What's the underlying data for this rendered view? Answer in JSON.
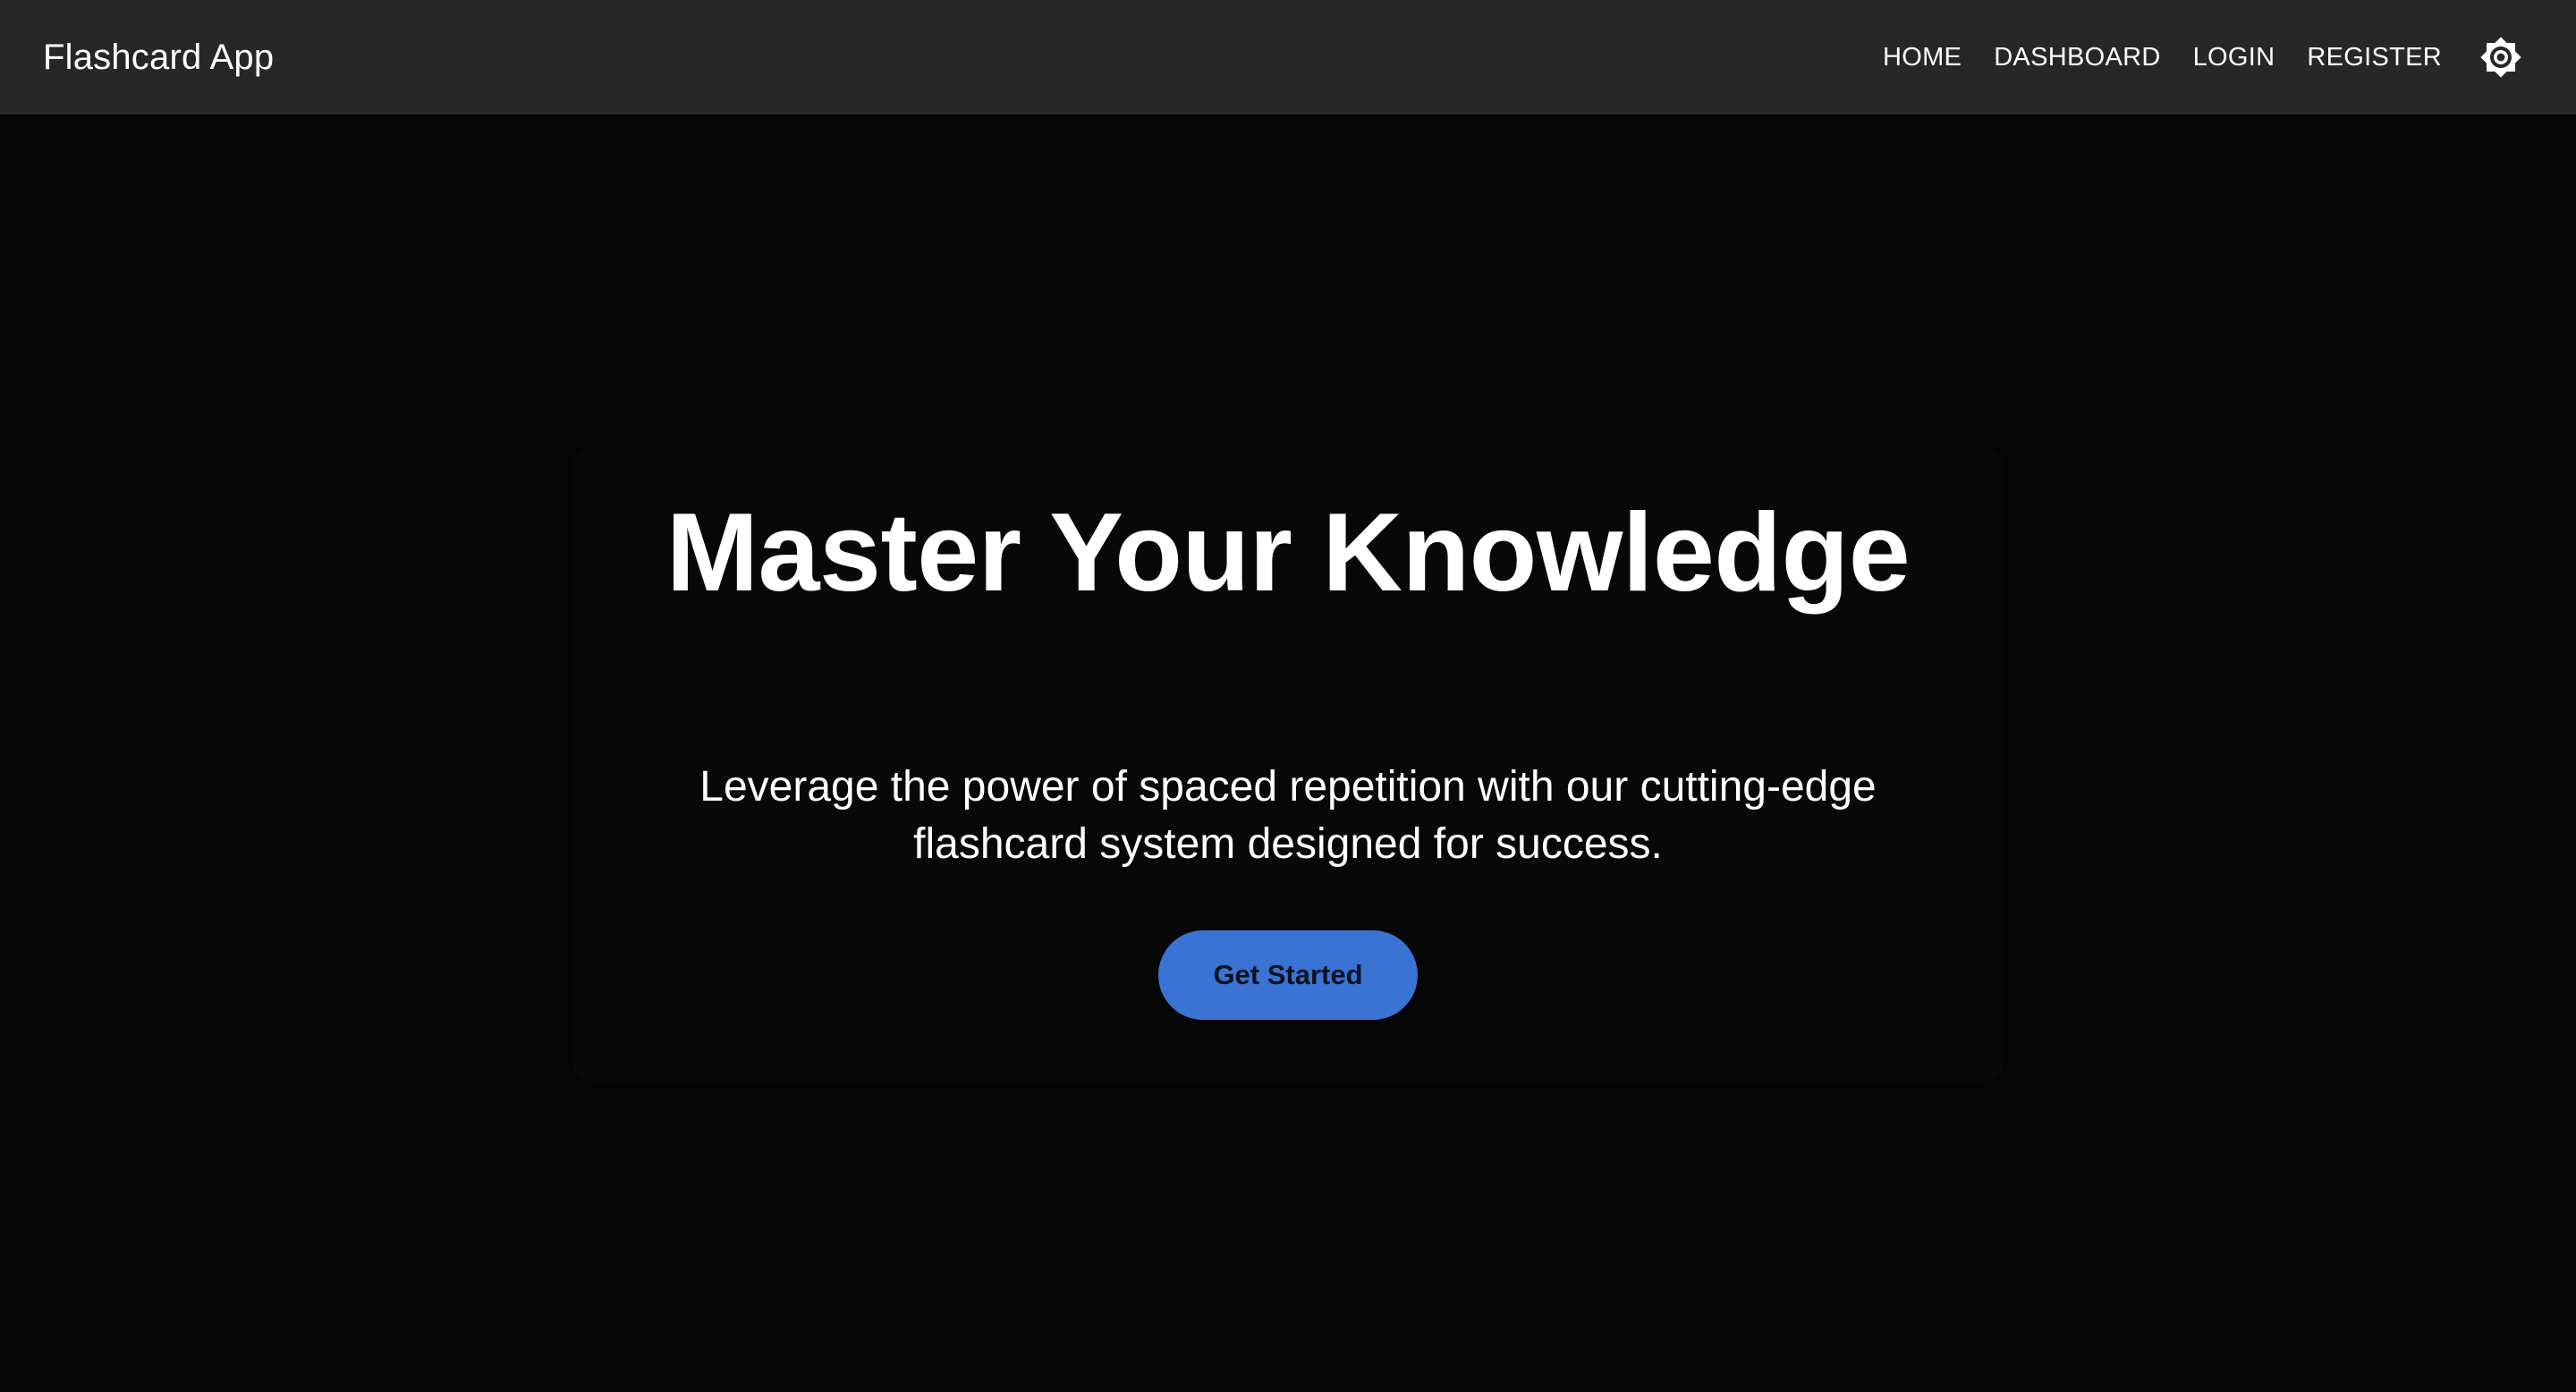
{
  "header": {
    "brand": "Flashcard App",
    "nav": [
      {
        "label": "HOME"
      },
      {
        "label": "DASHBOARD"
      },
      {
        "label": "LOGIN"
      },
      {
        "label": "REGISTER"
      }
    ],
    "theme_toggle_icon": "brightness-icon"
  },
  "hero": {
    "title": "Master Your Knowledge",
    "subtitle": "Leverage the power of spaced repetition with our cutting-edge flashcard system designed for success.",
    "cta_label": "Get Started"
  },
  "colors": {
    "header_bg": "#272727",
    "page_bg": "#070707",
    "text": "#ffffff",
    "accent": "#3a73d4"
  }
}
